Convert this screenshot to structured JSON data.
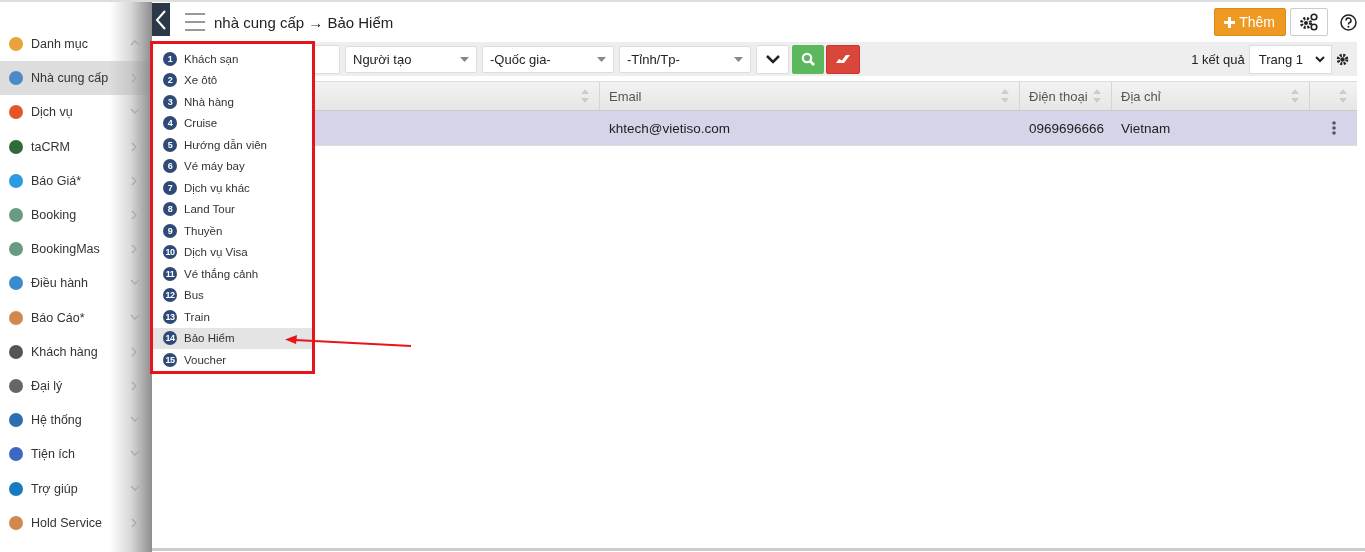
{
  "sidebar": {
    "items": [
      {
        "label": "Danh mục",
        "color": "#e8a33a",
        "kind": "group",
        "expanded": true,
        "selected": false
      },
      {
        "label": "Nhà cung cấp",
        "color": "#4a8ac9",
        "kind": "submenu",
        "selected": true
      },
      {
        "label": "Dịch vụ",
        "color": "#e8542a",
        "kind": "group",
        "expanded": false,
        "selected": false
      },
      {
        "label": "taCRM",
        "color": "#2f6b3a",
        "kind": "submenu",
        "selected": false
      },
      {
        "label": "Báo Giá*",
        "color": "#2a9be0",
        "kind": "submenu",
        "selected": false
      },
      {
        "label": "Booking",
        "color": "#6a9a80",
        "kind": "submenu",
        "selected": false
      },
      {
        "label": "BookingMas",
        "color": "#6a9a80",
        "kind": "submenu",
        "selected": false
      },
      {
        "label": "Điều hành",
        "color": "#3a8ad0",
        "kind": "group",
        "expanded": false,
        "selected": false
      },
      {
        "label": "Báo Cáo*",
        "color": "#d08a50",
        "kind": "group",
        "expanded": false,
        "selected": false
      },
      {
        "label": "Khách hàng",
        "color": "#555555",
        "kind": "submenu",
        "selected": false
      },
      {
        "label": "Đại lý",
        "color": "#666666",
        "kind": "submenu",
        "selected": false
      },
      {
        "label": "Hệ thống",
        "color": "#2a70b0",
        "kind": "group",
        "expanded": false,
        "selected": false
      },
      {
        "label": "Tiện ích",
        "color": "#3a6ac0",
        "kind": "group",
        "expanded": false,
        "selected": false
      },
      {
        "label": "Trợ giúp",
        "color": "#1a7ac0",
        "kind": "group",
        "expanded": false,
        "selected": false
      },
      {
        "label": "Hold Service",
        "color": "#d08a50",
        "kind": "submenu",
        "selected": false
      }
    ]
  },
  "header": {
    "title": "nhà cung cấp → Bảo Hiểm",
    "add_button": "Thêm"
  },
  "filters": [
    {
      "kind": "input"
    },
    {
      "kind": "select",
      "label": "Người tạo"
    },
    {
      "kind": "select",
      "label": "-Quốc gia-"
    },
    {
      "kind": "select",
      "label": "-Tỉnh/Tp-"
    },
    {
      "kind": "toggle"
    },
    {
      "kind": "search"
    },
    {
      "kind": "clear"
    }
  ],
  "result_count": "1 kết quả",
  "page_select": "Trang 1",
  "table": {
    "columns": [
      {
        "sortable": true
      },
      {
        "label": "Email",
        "sortable": true
      },
      {
        "label": "Điện thoại",
        "sortable": true
      },
      {
        "label": "Địa chỉ",
        "sortable": true
      },
      {
        "sortable": true
      }
    ],
    "rows": [
      {
        "selected": true,
        "cells": [
          "",
          "khtech@vietiso.com",
          "0969696666",
          "Vietnam",
          ""
        ]
      }
    ]
  },
  "supplier_menu": {
    "items": [
      {
        "number": "1",
        "label": "Khách sạn",
        "selected": false
      },
      {
        "number": "2",
        "label": "Xe ôtô",
        "selected": false
      },
      {
        "number": "3",
        "label": "Nhà hàng",
        "selected": false
      },
      {
        "number": "4",
        "label": "Cruise",
        "selected": false
      },
      {
        "number": "5",
        "label": "Hướng dẫn viên",
        "selected": false
      },
      {
        "number": "6",
        "label": "Vé máy bay",
        "selected": false
      },
      {
        "number": "7",
        "label": "Dịch vụ khác",
        "selected": false
      },
      {
        "number": "8",
        "label": "Land Tour",
        "selected": false
      },
      {
        "number": "9",
        "label": "Thuyền",
        "selected": false
      },
      {
        "number": "10",
        "label": "Dịch vụ Visa",
        "selected": false
      },
      {
        "number": "11",
        "label": "Vé thắng cảnh",
        "selected": false
      },
      {
        "number": "12",
        "label": "Bus",
        "selected": false
      },
      {
        "number": "13",
        "label": "Train",
        "selected": false
      },
      {
        "number": "14",
        "label": "Bảo Hiểm",
        "selected": true
      },
      {
        "number": "15",
        "label": "Voucher",
        "selected": false
      }
    ]
  }
}
